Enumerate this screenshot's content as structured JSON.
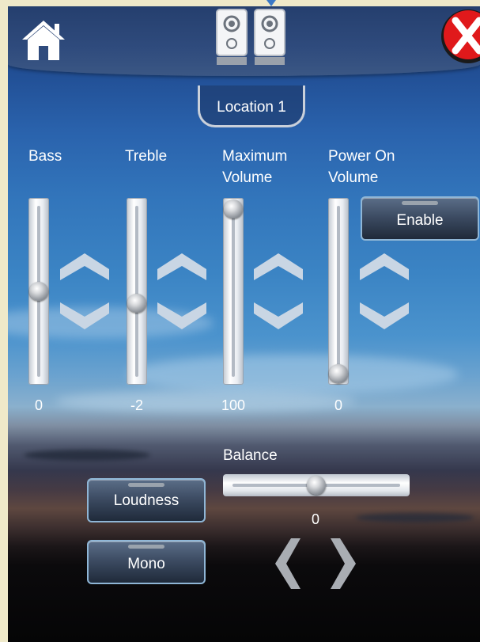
{
  "header": {
    "location_label": "Location 1"
  },
  "sliders": [
    {
      "label": "Bass",
      "value": "0",
      "level": 0.5
    },
    {
      "label": "Treble",
      "value": "-2",
      "level": 0.43
    },
    {
      "label": "Maximum\nVolume",
      "value": "100",
      "level": 1.0
    },
    {
      "label": "Power On\nVolume",
      "value": "0",
      "level": 0.0
    }
  ],
  "buttons": {
    "enable_label": "Enable",
    "loudness_label": "Loudness",
    "mono_label": "Mono"
  },
  "balance": {
    "label": "Balance",
    "value": "0",
    "level": 0.5
  },
  "icons": {
    "home": "home-icon",
    "speakers": "speakers-icon",
    "close": "close-icon",
    "up": "chevron-up-icon",
    "down": "chevron-down-icon",
    "left": "chevron-left-icon",
    "right": "chevron-right-icon"
  },
  "colors": {
    "close_red": "#e0191b",
    "button_border": "#8fb6d6",
    "arrow_fill": "#c9d6e4"
  }
}
